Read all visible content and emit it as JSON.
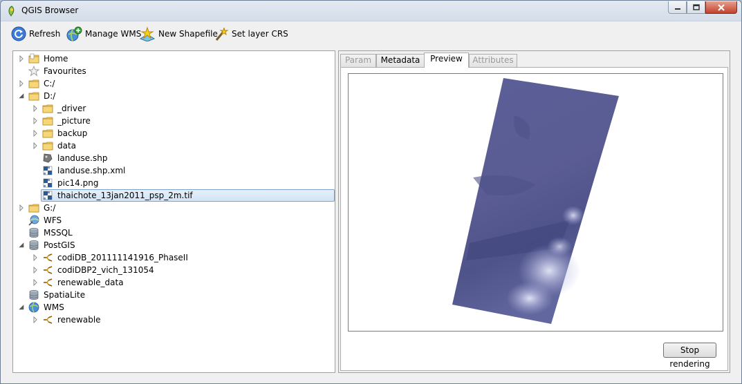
{
  "window": {
    "title": "QGIS Browser"
  },
  "toolbar": {
    "refresh": "Refresh",
    "manage_wms": "Manage WMS",
    "new_shapefile": "New Shapefile",
    "set_layer_crs": "Set layer CRS"
  },
  "tree": {
    "items": [
      {
        "label": "Home",
        "icon": "folder-home-icon",
        "level": 0,
        "expander": "collapsed"
      },
      {
        "label": "Favourites",
        "icon": "star-icon",
        "level": 0,
        "expander": "none"
      },
      {
        "label": "C:/",
        "icon": "folder-icon",
        "level": 0,
        "expander": "collapsed"
      },
      {
        "label": "D:/",
        "icon": "folder-icon",
        "level": 0,
        "expander": "expanded"
      },
      {
        "label": "_driver",
        "icon": "folder-icon",
        "level": 1,
        "expander": "collapsed"
      },
      {
        "label": "_picture",
        "icon": "folder-icon",
        "level": 1,
        "expander": "collapsed"
      },
      {
        "label": "backup",
        "icon": "folder-icon",
        "level": 1,
        "expander": "collapsed"
      },
      {
        "label": "data",
        "icon": "folder-icon",
        "level": 1,
        "expander": "collapsed"
      },
      {
        "label": "landuse.shp",
        "icon": "vector-layer-icon",
        "level": 1,
        "expander": "none"
      },
      {
        "label": "landuse.shp.xml",
        "icon": "raster-layer-icon",
        "level": 1,
        "expander": "none"
      },
      {
        "label": "pic14.png",
        "icon": "raster-layer-icon",
        "level": 1,
        "expander": "none"
      },
      {
        "label": "thaichote_13jan2011_psp_2m.tif",
        "icon": "raster-layer-icon",
        "level": 1,
        "expander": "none",
        "selected": true
      },
      {
        "label": "G:/",
        "icon": "folder-icon",
        "level": 0,
        "expander": "collapsed"
      },
      {
        "label": "WFS",
        "icon": "wfs-icon",
        "level": 0,
        "expander": "none"
      },
      {
        "label": "MSSQL",
        "icon": "database-icon",
        "level": 0,
        "expander": "none"
      },
      {
        "label": "PostGIS",
        "icon": "database-icon",
        "level": 0,
        "expander": "expanded"
      },
      {
        "label": "codiDB_201111141916_PhaseII",
        "icon": "connection-icon",
        "level": 1,
        "expander": "collapsed"
      },
      {
        "label": "codiDBP2_vich_131054",
        "icon": "connection-icon",
        "level": 1,
        "expander": "collapsed"
      },
      {
        "label": "renewable_data",
        "icon": "connection-icon",
        "level": 1,
        "expander": "collapsed"
      },
      {
        "label": "SpatiaLite",
        "icon": "database-icon",
        "level": 0,
        "expander": "none"
      },
      {
        "label": "WMS",
        "icon": "globe-icon",
        "level": 0,
        "expander": "expanded"
      },
      {
        "label": "renewable",
        "icon": "connection-icon",
        "level": 1,
        "expander": "collapsed"
      }
    ]
  },
  "tabs": [
    {
      "label": "Param",
      "state": "disabled"
    },
    {
      "label": "Metadata",
      "state": "normal"
    },
    {
      "label": "Preview",
      "state": "active"
    },
    {
      "label": "Attributes",
      "state": "disabled"
    }
  ],
  "preview": {
    "stop_button": "Stop rendering"
  },
  "colors": {
    "selection": "#d2e4f6",
    "raster_fill": "#5a5d9a",
    "folder": "#e8c45a"
  }
}
